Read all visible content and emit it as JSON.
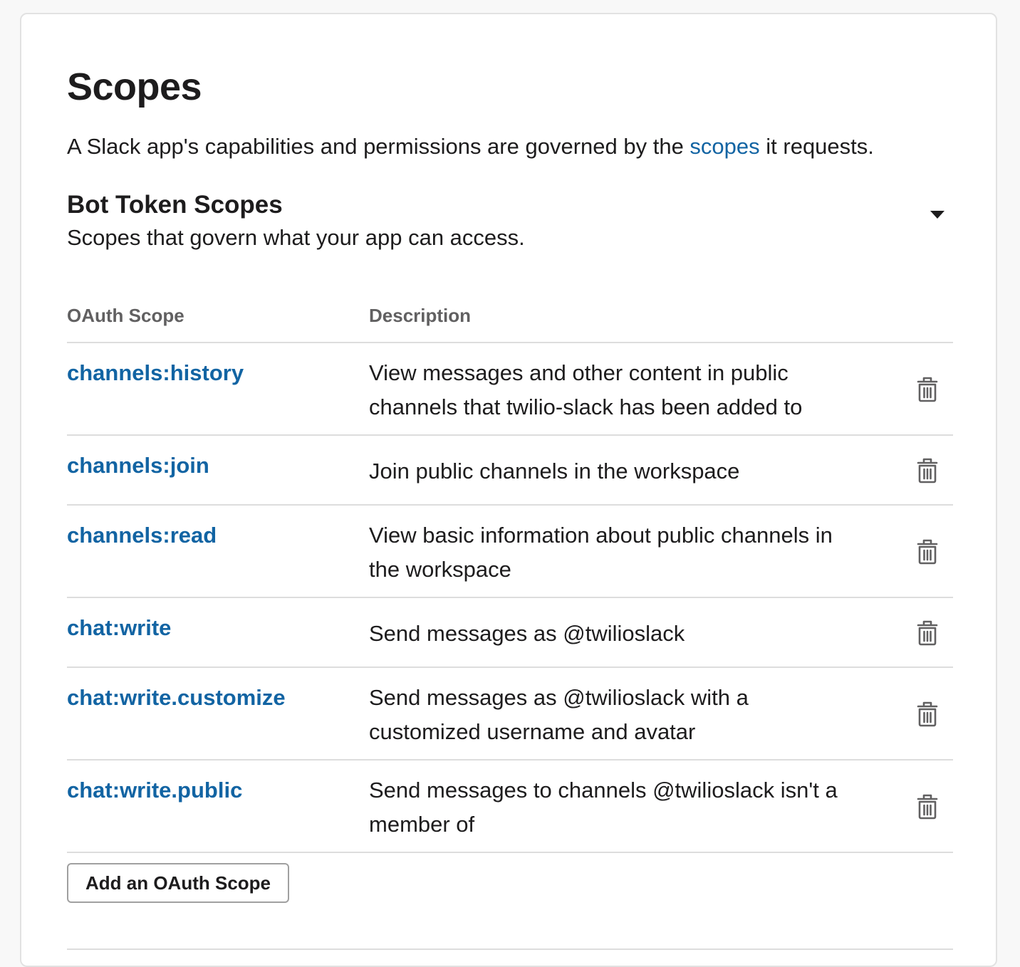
{
  "header": {
    "title": "Scopes",
    "intro_before": "A Slack app's capabilities and permissions are governed by the ",
    "intro_link": "scopes",
    "intro_after": " it requests."
  },
  "bot_section": {
    "title": "Bot Token Scopes",
    "subtitle": "Scopes that govern what your app can access.",
    "toggle_icon": "caret-down-icon"
  },
  "table": {
    "col_scope": "OAuth Scope",
    "col_description": "Description",
    "rows": [
      {
        "scope": "channels:history",
        "description": "View messages and other content in public channels that twilio-slack has been added to"
      },
      {
        "scope": "channels:join",
        "description": "Join public channels in the workspace"
      },
      {
        "scope": "channels:read",
        "description": "View basic information about public channels in the workspace"
      },
      {
        "scope": "chat:write",
        "description": "Send messages as @twilioslack"
      },
      {
        "scope": "chat:write.customize",
        "description": "Send messages as @twilioslack with a customized username and avatar"
      },
      {
        "scope": "chat:write.public",
        "description": "Send messages to channels @twilioslack isn't a member of"
      }
    ],
    "row_action_icon": "trash-icon"
  },
  "add_button": {
    "label": "Add an OAuth Scope"
  },
  "colors": {
    "link": "#1264a3",
    "text": "#1d1c1d",
    "muted": "#616061",
    "divider": "#dddddd"
  }
}
